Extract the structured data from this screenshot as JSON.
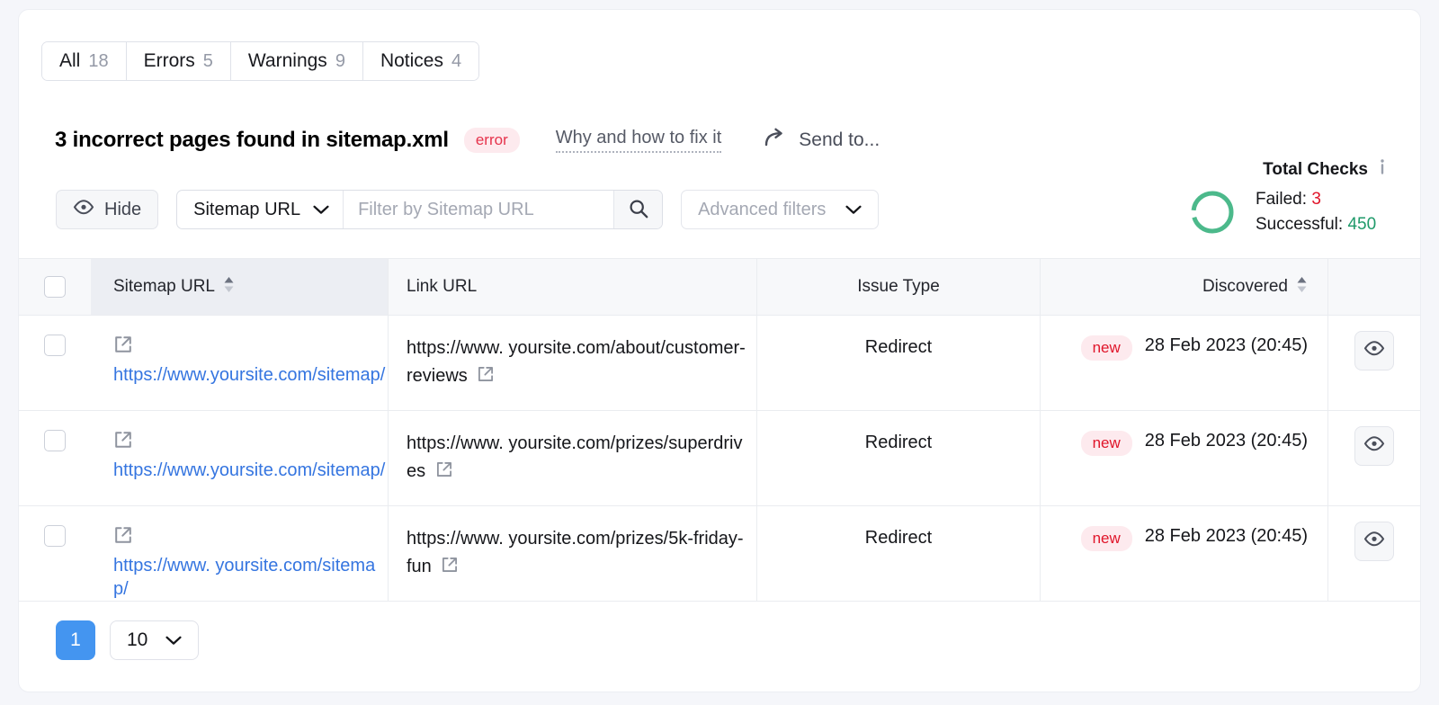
{
  "tabs": [
    {
      "label": "All",
      "count": "18"
    },
    {
      "label": "Errors",
      "count": "5"
    },
    {
      "label": "Warnings",
      "count": "9"
    },
    {
      "label": "Notices",
      "count": "4"
    }
  ],
  "header": {
    "title": "3 incorrect pages found in sitemap.xml",
    "severity_badge": "error",
    "fix_link": "Why and how to fix it",
    "send_to": "Send to...",
    "severity_color": "#e6334c"
  },
  "filters": {
    "hide_label": "Hide",
    "column_select": "Sitemap URL",
    "search_placeholder": "Filter by Sitemap URL",
    "search_value": "",
    "advanced_filters": "Advanced filters"
  },
  "total_checks": {
    "title": "Total Checks",
    "failed_label": "Failed:",
    "failed_value": "3",
    "successful_label": "Successful:",
    "successful_value": "450",
    "failed_color": "#e0152a",
    "successful_color": "#1f9a6a",
    "donut_color": "#4cb98b"
  },
  "table": {
    "columns": [
      {
        "label": "Sitemap URL",
        "sortable": true
      },
      {
        "label": "Link URL",
        "sortable": false
      },
      {
        "label": "Issue Type",
        "sortable": false
      },
      {
        "label": "Discovered",
        "sortable": true
      }
    ],
    "rows": [
      {
        "sitemap_url": "https://www.yoursite.com/sitemap/",
        "link_url": "https://www. yoursite.com/about/customer-reviews",
        "issue_type": "Redirect",
        "badge": "new",
        "discovered": "28 Feb 2023 (20:45)"
      },
      {
        "sitemap_url": "https://www.yoursite.com/sitemap/",
        "link_url": "https://www. yoursite.com/prizes/superdrives",
        "issue_type": "Redirect",
        "badge": "new",
        "discovered": "28 Feb 2023 (20:45)"
      },
      {
        "sitemap_url": "https://www. yoursite.com/sitemap/",
        "link_url": "https://www. yoursite.com/prizes/5k-friday-fun",
        "issue_type": "Redirect",
        "badge": "new",
        "discovered": "28 Feb 2023 (20:45)"
      }
    ]
  },
  "footer": {
    "page_number": "1",
    "per_page": "10"
  }
}
